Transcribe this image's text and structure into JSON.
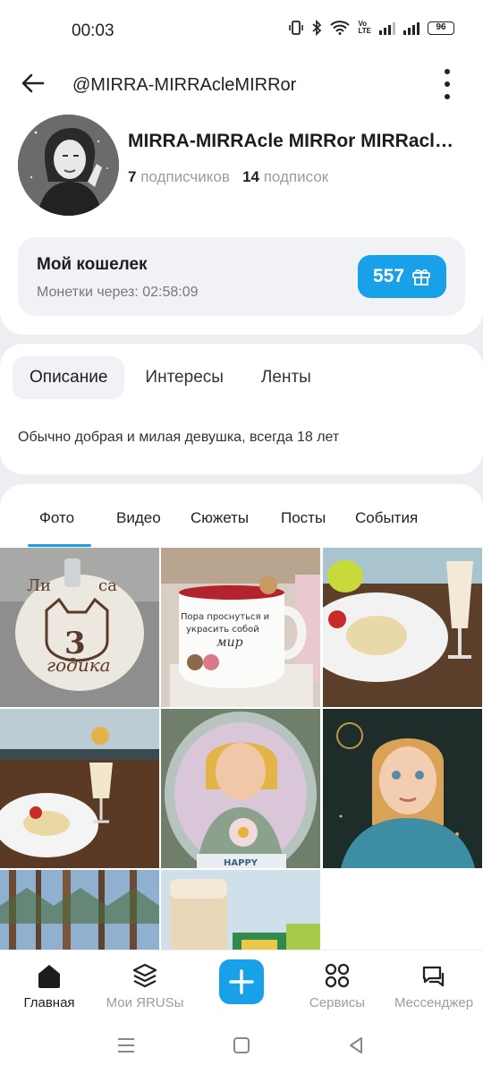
{
  "status_bar": {
    "time": "00:03",
    "battery": "96",
    "volte": "VoLTE"
  },
  "header": {
    "handle": "@MIRRA-MIRRAcleMIRRor"
  },
  "profile": {
    "name": "MIRRA-MIRRAcle MIRRor MIRRacle MIRRor",
    "followers_count": "7",
    "followers_label": "подписчиков",
    "following_count": "14",
    "following_label": "подписок"
  },
  "wallet": {
    "title": "Мой кошелек",
    "coins_timer": "Монетки через: 02:58:09",
    "balance": "557"
  },
  "about_tabs": [
    {
      "label": "Описание",
      "active": true
    },
    {
      "label": "Интересы",
      "active": false
    },
    {
      "label": "Ленты",
      "active": false
    }
  ],
  "about_text": "Обычно добрая и милая девушка, всегда 18 лет",
  "media_tabs": [
    {
      "label": "Фото",
      "active": true
    },
    {
      "label": "Видео",
      "active": false
    },
    {
      "label": "Сюжеты",
      "active": false
    },
    {
      "label": "Посты",
      "active": false
    },
    {
      "label": "События",
      "active": false
    }
  ],
  "photos": {
    "cake_text_top": "Ли",
    "cake_text_top2": "са",
    "cake_digit": "3",
    "cake_word": "годика",
    "cup_line1": "Пора проснуться и",
    "cup_line2": "украсить собой",
    "cup_line3": "мир",
    "card_text": "HAPPY"
  },
  "bottom_nav": [
    {
      "label": "Главная",
      "icon": "home-icon",
      "active": true
    },
    {
      "label": "Мои ЯRUSы",
      "icon": "layers-icon",
      "active": false
    },
    {
      "label": "",
      "icon": "plus-icon",
      "active": false
    },
    {
      "label": "Сервисы",
      "icon": "grid-icon",
      "active": false
    },
    {
      "label": "Мессенджер",
      "icon": "chat-icon",
      "active": false
    }
  ],
  "colors": {
    "accent": "#18a0e8",
    "background": "#eceef1",
    "card": "#ffffff",
    "muted": "#9a9ca2"
  }
}
